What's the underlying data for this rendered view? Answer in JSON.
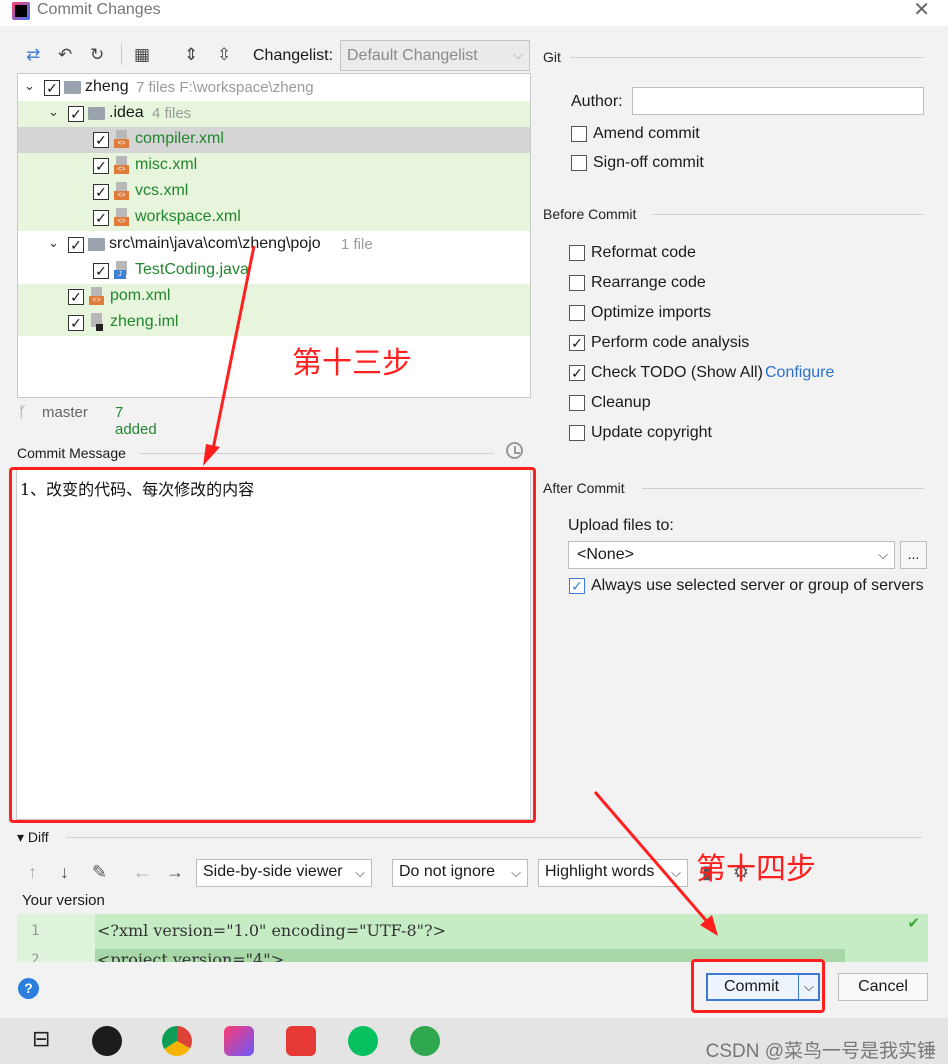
{
  "window": {
    "title": "Commit Changes"
  },
  "toolbar": {
    "icons": [
      "diff-icon",
      "undo-icon",
      "refresh-icon",
      "group-icon",
      "expand-all-icon",
      "collapse-all-icon"
    ],
    "changelist_label": "Changelist:",
    "changelist_value": "Default Changelist"
  },
  "tree": [
    {
      "name": "zheng",
      "meta": "7 files  F:\\workspace\\zheng",
      "type": "module",
      "green": false
    },
    {
      "name": ".idea",
      "meta": "4 files",
      "type": "folder",
      "green": true
    },
    {
      "name": "compiler.xml",
      "meta": "",
      "type": "xml",
      "green": true,
      "selected": true
    },
    {
      "name": "misc.xml",
      "meta": "",
      "type": "xml",
      "green": true
    },
    {
      "name": "vcs.xml",
      "meta": "",
      "type": "xml",
      "green": true
    },
    {
      "name": "workspace.xml",
      "meta": "",
      "type": "xml",
      "green": true
    },
    {
      "name": "src\\main\\java\\com\\zheng\\pojo",
      "meta": "1 file",
      "type": "folder",
      "green": false
    },
    {
      "name": "TestCoding.java",
      "meta": "",
      "type": "java",
      "green": false
    },
    {
      "name": "pom.xml",
      "meta": "",
      "type": "xml",
      "green": true
    },
    {
      "name": "zheng.iml",
      "meta": "",
      "type": "iml",
      "green": true
    }
  ],
  "status": {
    "branch": "master",
    "added": "7 added"
  },
  "commit_message": {
    "label": "Commit Message",
    "text": "1、改变的代码、每次修改的内容"
  },
  "git": {
    "section_title": "Git",
    "author_label": "Author:",
    "author_value": "",
    "amend_commit": {
      "label": "Amend commit",
      "checked": false
    },
    "signoff_commit": {
      "label": "Sign-off commit",
      "checked": false
    }
  },
  "before_commit": {
    "section_title": "Before Commit",
    "options": [
      {
        "label": "Reformat code",
        "checked": false
      },
      {
        "label": "Rearrange code",
        "checked": false
      },
      {
        "label": "Optimize imports",
        "checked": false
      },
      {
        "label": "Perform code analysis",
        "checked": true
      },
      {
        "label": "Check TODO (Show All)",
        "checked": true,
        "link": "Configure"
      },
      {
        "label": "Cleanup",
        "checked": false
      },
      {
        "label": "Update copyright",
        "checked": false
      }
    ]
  },
  "after_commit": {
    "section_title": "After Commit",
    "upload_label": "Upload files to:",
    "upload_value": "<None>",
    "more_button": "...",
    "always_use": {
      "label": "Always use selected server or group of servers",
      "checked": true
    }
  },
  "diff": {
    "label": "Diff",
    "viewer": "Side-by-side viewer",
    "ignore": "Do not ignore",
    "highlight": "Highlight words",
    "your_version": "Your version",
    "lines": [
      {
        "num": "1",
        "text": "<?xml version=\"1.0\" encoding=\"UTF-8\"?>"
      },
      {
        "num": "2",
        "text": "<project version=\"4\">"
      }
    ]
  },
  "buttons": {
    "help": "?",
    "commit": "Commit",
    "cancel": "Cancel"
  },
  "annotations": {
    "step13": "第十三步",
    "step14": "第十四步"
  },
  "watermark": "CSDN @菜鸟一号是我实锤",
  "colors": {
    "annotation_red": "#ff1f1f",
    "added_green": "#23862f",
    "link_blue": "#2b6fd0"
  }
}
